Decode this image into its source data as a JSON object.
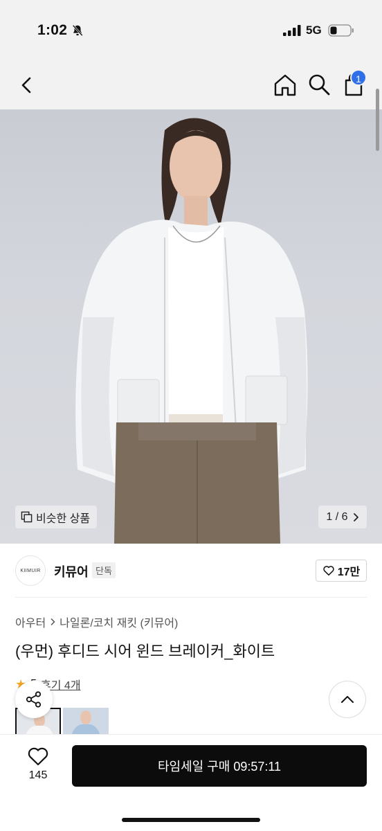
{
  "status_bar": {
    "time": "1:02",
    "network": "5G",
    "icons": [
      "bell-off-icon",
      "signal-icon",
      "battery-icon"
    ]
  },
  "nav": {
    "icons": [
      "back-arrow-icon",
      "home-icon",
      "search-icon",
      "cart-icon"
    ],
    "cart_badge": "1"
  },
  "gallery": {
    "similar_label": "비슷한 상품",
    "pager": "1 / 6"
  },
  "brand": {
    "logo_text": "KIIMUIR",
    "name": "키뮤어",
    "badge": "단독",
    "likes": "17만"
  },
  "breadcrumb": {
    "category": "아우터",
    "subcategory": "나일론/코치 재킷 (키뮤어)"
  },
  "product": {
    "title": "(우먼) 후디드 시어 윈드 브레이커_화이트",
    "review_score": "5",
    "review_link": "후기 4개"
  },
  "bottom_bar": {
    "wish_count": "145",
    "buy_label": "타임세일 구매 09:57:11"
  },
  "colors": {
    "accent": "#2f6fe8",
    "buy_button": "#0c0c0c",
    "star": "#f5a623"
  }
}
